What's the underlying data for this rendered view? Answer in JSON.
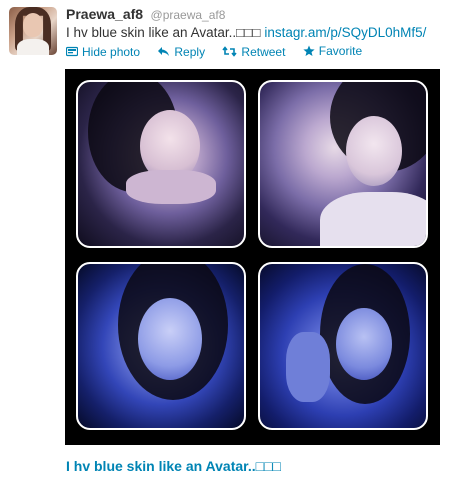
{
  "tweet": {
    "display_name": "Praewa_af8",
    "handle": "@praewa_af8",
    "text": "I hv blue skin like an Avatar..□□□ ",
    "link": "instagr.am/p/SQyDL0hMf5/"
  },
  "actions": {
    "hide_photo": "Hide photo",
    "reply": "Reply",
    "retweet": "Retweet",
    "favorite": "Favorite"
  },
  "photo": {
    "caption": "I hv blue skin like an Avatar..□□□"
  },
  "colors": {
    "link": "#0084b4",
    "text": "#333333",
    "muted": "#999999"
  },
  "icons": [
    "photo-icon",
    "reply-icon",
    "retweet-icon",
    "favorite-star-icon"
  ]
}
